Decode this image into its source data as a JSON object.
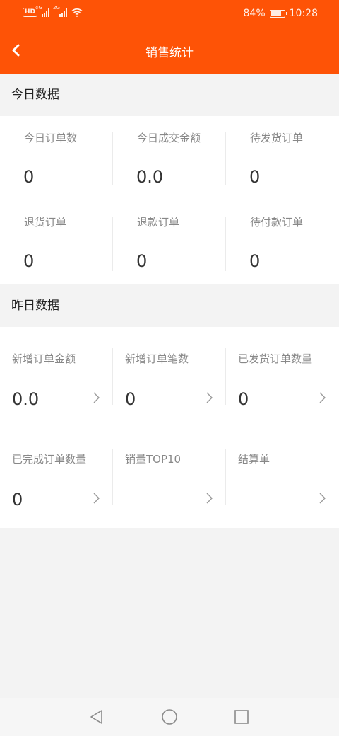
{
  "status_bar": {
    "time": "10:28",
    "battery": "84%",
    "battery_level": 0.84,
    "hd": "HD",
    "net1": "4G",
    "net2": "2G",
    "icons": [
      "hd-icon",
      "signal-icon",
      "signal-icon",
      "wifi-icon",
      "battery-icon"
    ]
  },
  "header": {
    "title": "销售统计",
    "back_icon": "chevron-left-icon",
    "color": "#fe5306"
  },
  "today": {
    "title": "今日数据",
    "items": [
      {
        "label": "今日订单数",
        "value": "0"
      },
      {
        "label": "今日成交金额",
        "value": "0.0"
      },
      {
        "label": "待发货订单",
        "value": "0"
      },
      {
        "label": "退货订单",
        "value": "0"
      },
      {
        "label": "退款订单",
        "value": "0"
      },
      {
        "label": "待付款订单",
        "value": "0"
      }
    ]
  },
  "yesterday": {
    "title": "昨日数据",
    "items": [
      {
        "label": "新增订单金额",
        "value": "0.0"
      },
      {
        "label": "新增订单笔数",
        "value": "0"
      },
      {
        "label": "已发货订单数量",
        "value": "0"
      },
      {
        "label": "已完成订单数量",
        "value": "0"
      },
      {
        "label": "销量TOP10",
        "value": ""
      },
      {
        "label": "结算单",
        "value": ""
      }
    ],
    "arrow_icon": "chevron-right-icon"
  },
  "nav": {
    "icons": [
      "back-triangle-icon",
      "home-circle-icon",
      "recents-square-icon"
    ]
  }
}
